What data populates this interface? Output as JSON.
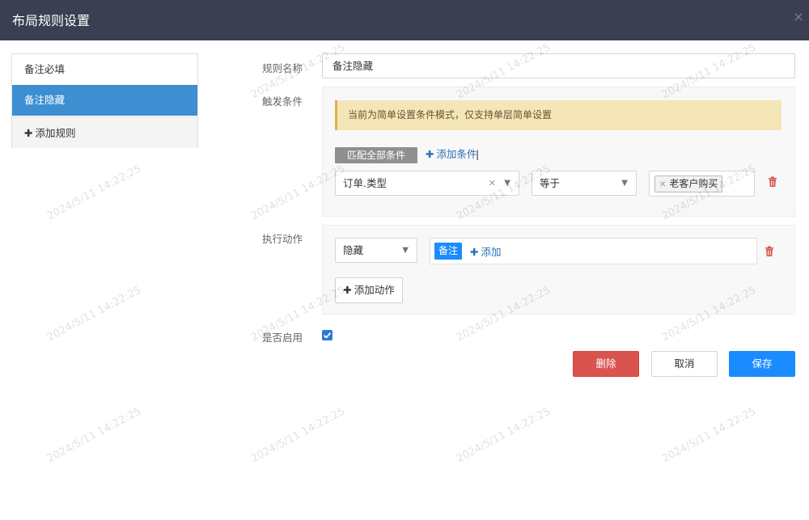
{
  "dialog": {
    "title": "布局规则设置",
    "close_glyph": "×"
  },
  "watermark_text": "2024/5/11 14:22:25",
  "sidebar": {
    "items": [
      {
        "label": "备注必填",
        "active": false
      },
      {
        "label": "备注隐藏",
        "active": true
      }
    ],
    "add_rule_label": "添加规则"
  },
  "form": {
    "rule_name_label": "规则名称",
    "rule_name_value": "备注隐藏",
    "trigger_label": "触发条件",
    "trigger": {
      "notice": "当前为简单设置条件模式，仅支持单层简单设置",
      "match_mode": "匹配全部条件",
      "add_condition_label": "添加条件",
      "separator": "|",
      "condition": {
        "field": "订单.类型",
        "operator": "等于",
        "values": [
          "老客户购买"
        ]
      }
    },
    "action_label": "执行动作",
    "action": {
      "type": "隐藏",
      "field_tag": "备注",
      "add_field_label": "添加",
      "add_action_label": "添加动作"
    },
    "enabled_label": "是否启用",
    "enabled": true
  },
  "buttons": {
    "delete": "删除",
    "cancel": "取消",
    "save": "保存"
  },
  "colors": {
    "header_bg": "#3a3f51",
    "active_item": "#3d8fd1",
    "notice_bg": "#f5e6b8",
    "link": "#2c6fb8",
    "danger": "#d9534f",
    "primary": "#1a8cff"
  },
  "icons": {
    "close": "close-icon",
    "plus": "plus-icon",
    "dropdown": "chevron-down-icon",
    "clear": "clear-icon",
    "trash": "trash-icon",
    "check": "check-icon"
  }
}
